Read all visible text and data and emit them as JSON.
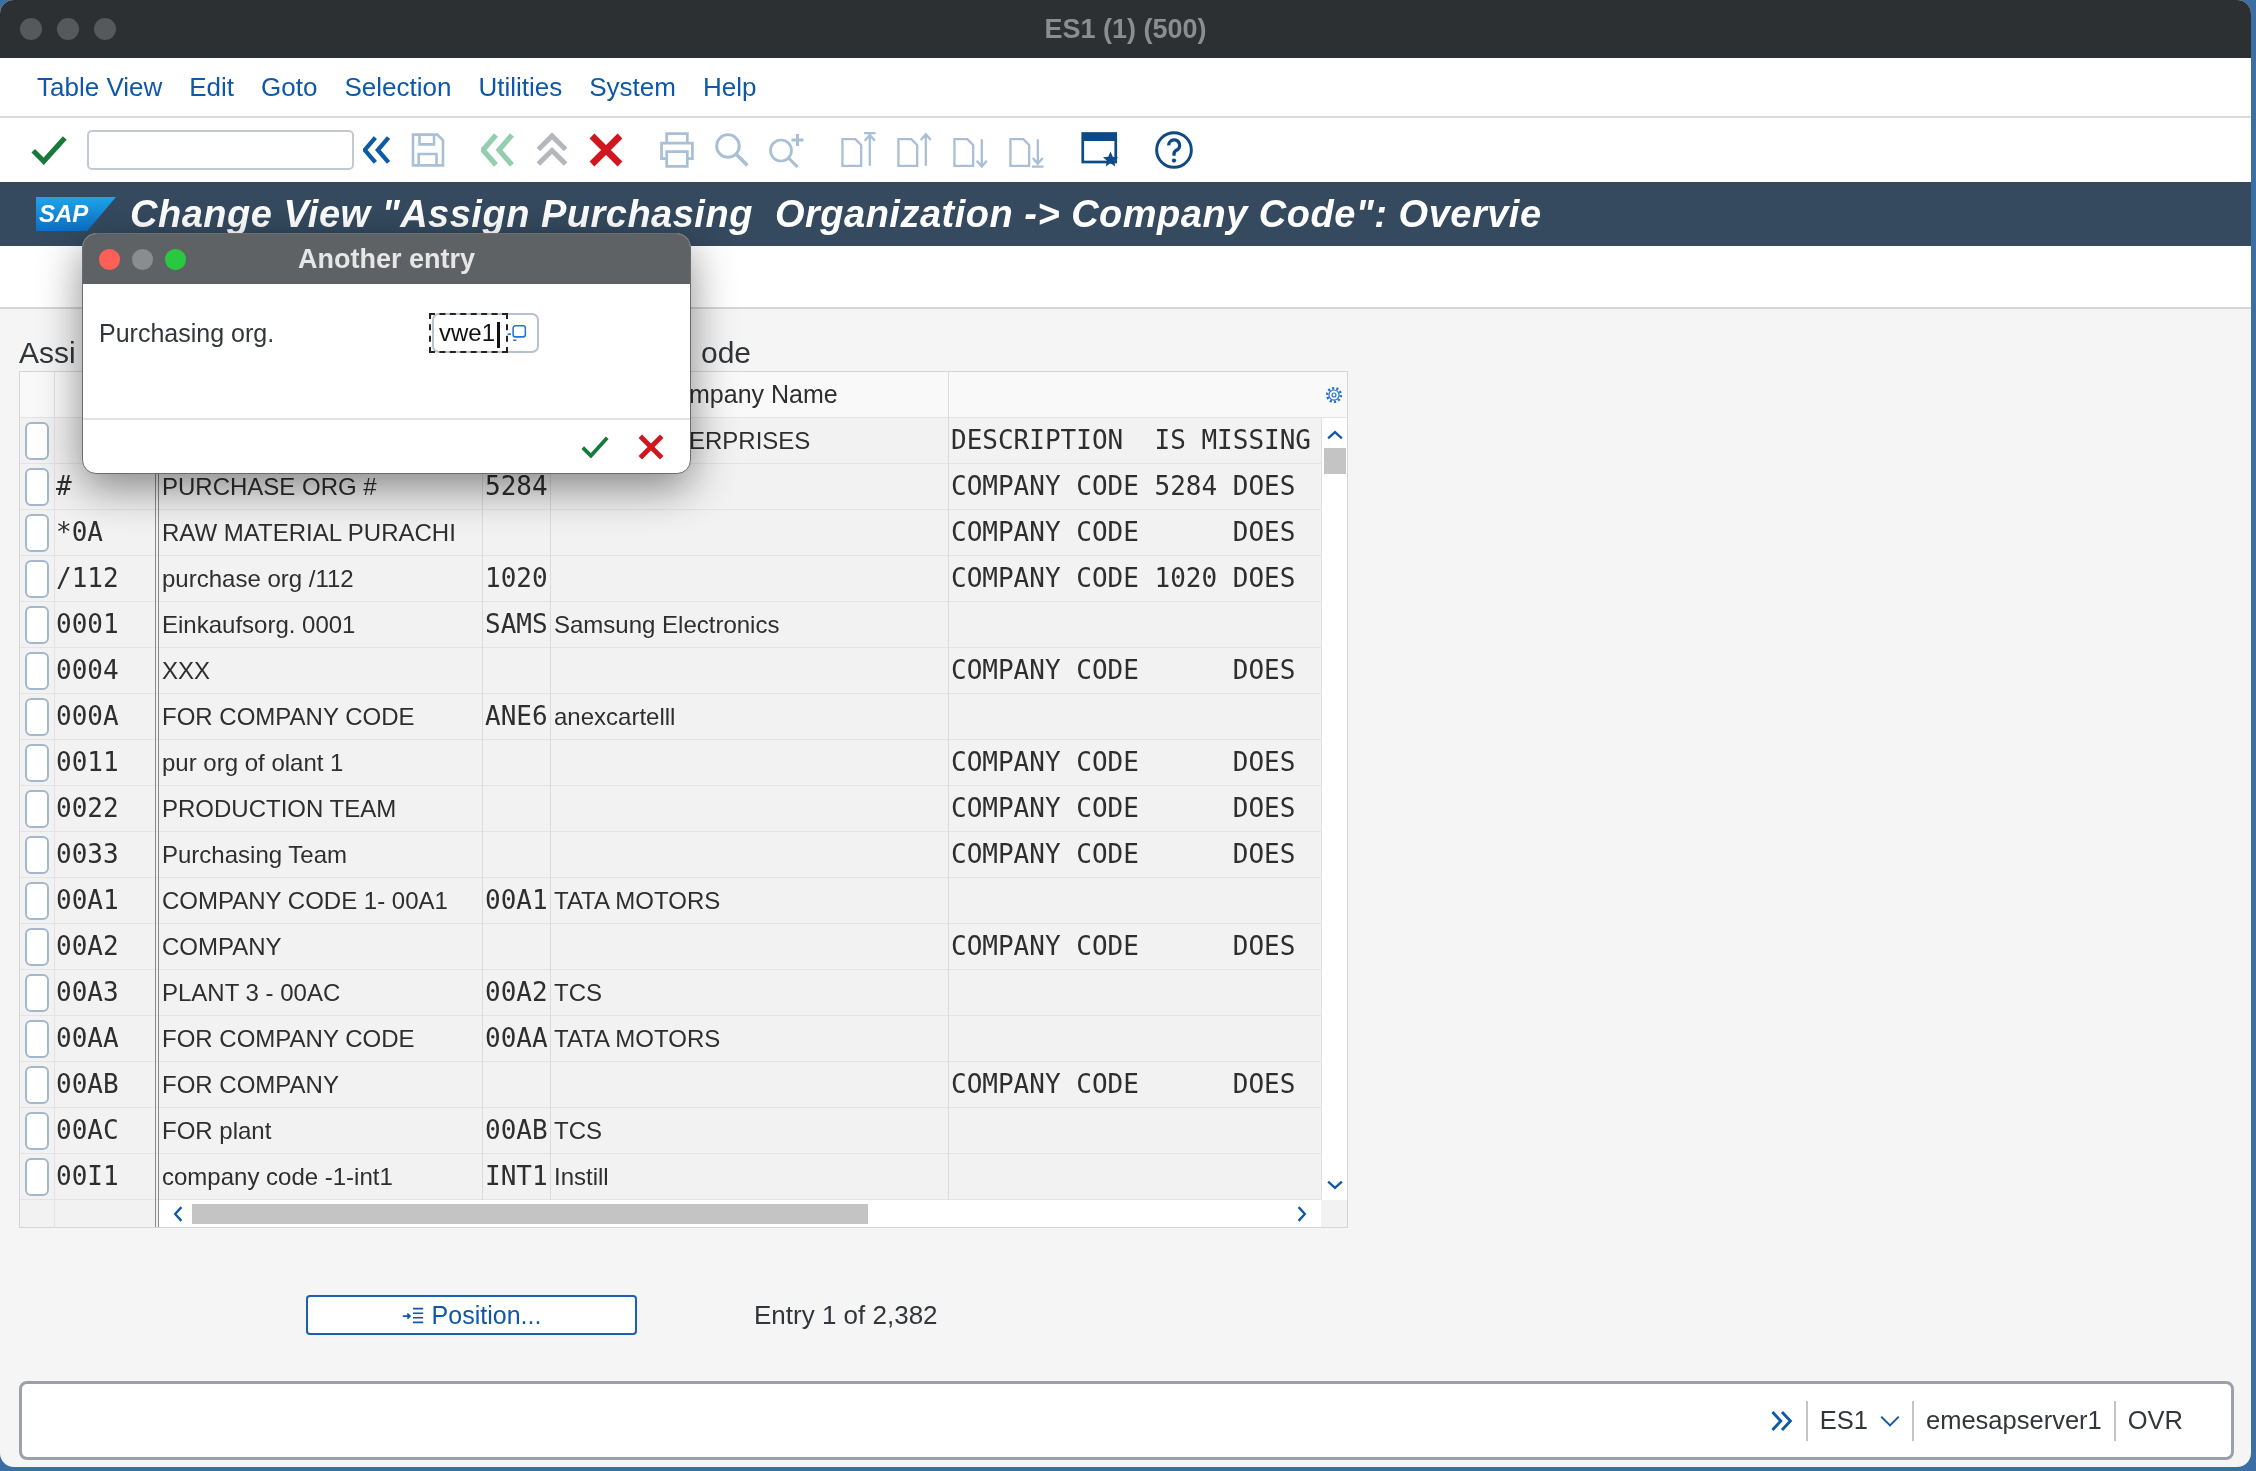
{
  "window": {
    "title": "ES1 (1) (500)",
    "active": false
  },
  "menu_bar": [
    "Table View",
    "Edit",
    "Goto",
    "Selection",
    "Utilities",
    "System",
    "Help"
  ],
  "toolbar": [
    [
      {
        "kind": "enter",
        "disabled": false
      },
      {
        "kind": "command-field"
      },
      {
        "kind": "collapse",
        "disabled": false
      },
      {
        "kind": "save",
        "disabled": true
      }
    ],
    [
      {
        "kind": "back",
        "disabled": true
      },
      {
        "kind": "exit",
        "disabled": true
      },
      {
        "kind": "cancel",
        "disabled": false
      }
    ],
    [
      {
        "kind": "print",
        "disabled": true
      },
      {
        "kind": "find",
        "disabled": true
      },
      {
        "kind": "find-next",
        "disabled": true
      }
    ],
    [
      {
        "kind": "first-page",
        "disabled": true
      },
      {
        "kind": "previous-page",
        "disabled": true
      },
      {
        "kind": "next-page",
        "disabled": true
      },
      {
        "kind": "last-page",
        "disabled": true
      }
    ],
    [
      {
        "kind": "layout",
        "disabled": false
      }
    ],
    [
      {
        "kind": "help",
        "disabled": false
      }
    ]
  ],
  "title_bar": {
    "logo": "SAP",
    "title": "Change View \"Assign Purchasing  Organization -> Company Code\": Overvie"
  },
  "group_title": [
    "Assi",
    "ode"
  ],
  "table": {
    "header": {
      "column_4": "mpany Name"
    },
    "rows": [
      {
        "selected": false,
        "column_4": "ERPRISES",
        "column_5": "DESCRIPTION  IS MISSING"
      },
      {
        "selected": false,
        "column_1": "#",
        "column_2": "PURCHASE ORG #",
        "column_3": "5284",
        "column_5": "COMPANY CODE 5284 DOES"
      },
      {
        "selected": false,
        "column_1": "*0A",
        "column_2": "RAW MATERIAL PURACHI",
        "column_5": "COMPANY CODE      DOES"
      },
      {
        "selected": false,
        "column_1": "/112",
        "column_2": "purchase org /112",
        "column_3": "1020",
        "column_5": "COMPANY CODE 1020 DOES"
      },
      {
        "selected": false,
        "column_1": "0001",
        "column_2": "Einkaufsorg. 0001",
        "column_3": "SAMS",
        "column_4": "Samsung Electronics"
      },
      {
        "selected": false,
        "column_1": "0004",
        "column_2": "XXX",
        "column_5": "COMPANY CODE      DOES"
      },
      {
        "selected": false,
        "column_1": "000A",
        "column_2": "FOR COMPANY CODE",
        "column_3": "ANE6",
        "column_4": "anexcartelll"
      },
      {
        "selected": false,
        "column_1": "0011",
        "column_2": "pur org of olant 1",
        "column_5": "COMPANY CODE      DOES"
      },
      {
        "selected": false,
        "column_1": "0022",
        "column_2": "PRODUCTION TEAM",
        "column_5": "COMPANY CODE      DOES"
      },
      {
        "selected": false,
        "column_1": "0033",
        "column_2": "Purchasing Team",
        "column_5": "COMPANY CODE      DOES"
      },
      {
        "selected": false,
        "column_1": "00A1",
        "column_2": "COMPANY CODE 1- 00A1",
        "column_3": "00A1",
        "column_4": "TATA MOTORS"
      },
      {
        "selected": false,
        "column_1": "00A2",
        "column_2": "COMPANY",
        "column_5": "COMPANY CODE      DOES"
      },
      {
        "selected": false,
        "column_1": "00A3",
        "column_2": "PLANT 3 - 00AC",
        "column_3": "00A2",
        "column_4": "TCS"
      },
      {
        "selected": false,
        "column_1": "00AA",
        "column_2": "FOR COMPANY CODE",
        "column_3": "00AA",
        "column_4": "TATA MOTORS"
      },
      {
        "selected": false,
        "column_1": "00AB",
        "column_2": "FOR COMPANY",
        "column_5": "COMPANY CODE      DOES"
      },
      {
        "selected": false,
        "column_1": "00AC",
        "column_2": "FOR plant",
        "column_3": "00AB",
        "column_4": "TCS"
      },
      {
        "selected": false,
        "column_1": "00I1",
        "column_2": "company code -1-int1",
        "column_3": "INT1",
        "column_4": "Instill"
      }
    ]
  },
  "position_button": {
    "label": "Position..."
  },
  "entry_info": "Entry 1 of 2,382",
  "status_bar": {
    "system": "ES1",
    "server": "emesapserver1",
    "mode": "OVR"
  },
  "dialog": {
    "title": "Another entry",
    "active": true,
    "field": {
      "label": "Purchasing org.",
      "value": "vwe1",
      "focused": true
    }
  }
}
